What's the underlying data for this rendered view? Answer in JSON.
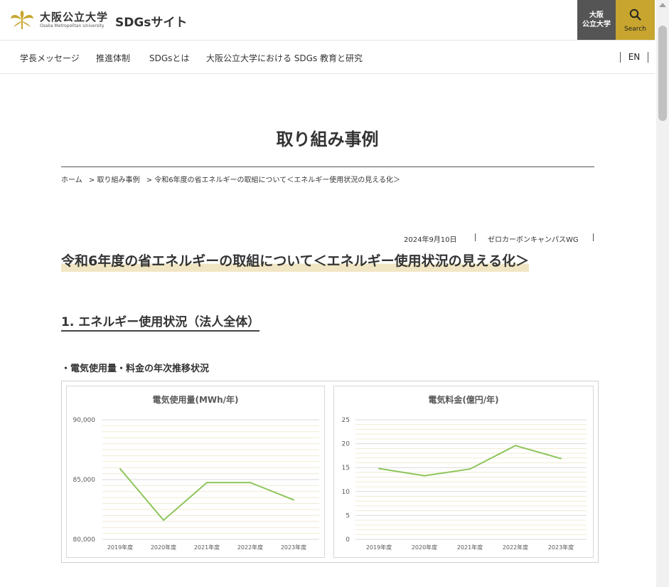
{
  "header": {
    "univ_name": "大阪公立大学",
    "univ_name_en": "Osaka Metropolitan University",
    "site_title": "SDGsサイト",
    "univ_button_line1": "大阪",
    "univ_button_line2": "公立大学",
    "search_label": "Search",
    "logo_icon": "ginkgo-logo-icon",
    "search_icon": "magnifier-icon",
    "accent_color": "#c7a52f"
  },
  "nav": {
    "items": [
      "学長メッセージ",
      "推進体制",
      "SDGsとは",
      "大阪公立大学における SDGs 教育と研究"
    ],
    "lang": "EN"
  },
  "page": {
    "title": "取り組み事例"
  },
  "breadcrumb": [
    "ホーム",
    ">  取り組み事例",
    ">  令和6年度の省エネルギーの取組について＜エネルギー使用状況の見える化＞"
  ],
  "article": {
    "date": "2024年9月10日",
    "category": "ゼロカーボンキャンパスWG",
    "title": "令和6年度の省エネルギーの取組について＜エネルギー使用状況の見える化＞",
    "section_heading": "1. エネルギー使用状況（法人全体）",
    "sub_heading": "・電気使用量・料金の年次推移状況"
  },
  "chart_data": [
    {
      "type": "line",
      "title": "電気使用量(MWh/年)",
      "categories": [
        "2019年度",
        "2020年度",
        "2021年度",
        "2022年度",
        "2023年度"
      ],
      "series": [
        {
          "values": [
            85900,
            81600,
            84750,
            84750,
            83300
          ]
        }
      ],
      "ylim": [
        80000,
        90000
      ],
      "yticks": [
        "80,000",
        "85,000",
        "90,000"
      ],
      "line_color": "#8dc55a",
      "grid": true
    },
    {
      "type": "line",
      "title": "電気料金(億円/年)",
      "categories": [
        "2019年度",
        "2020年度",
        "2021年度",
        "2022年度",
        "2023年度"
      ],
      "series": [
        {
          "values": [
            14.8,
            13.3,
            14.7,
            19.6,
            16.9
          ]
        }
      ],
      "ylim": [
        0,
        25
      ],
      "yticks": [
        "0",
        "5",
        "10",
        "15",
        "20",
        "25"
      ],
      "line_color": "#8dc55a",
      "grid": true
    }
  ]
}
